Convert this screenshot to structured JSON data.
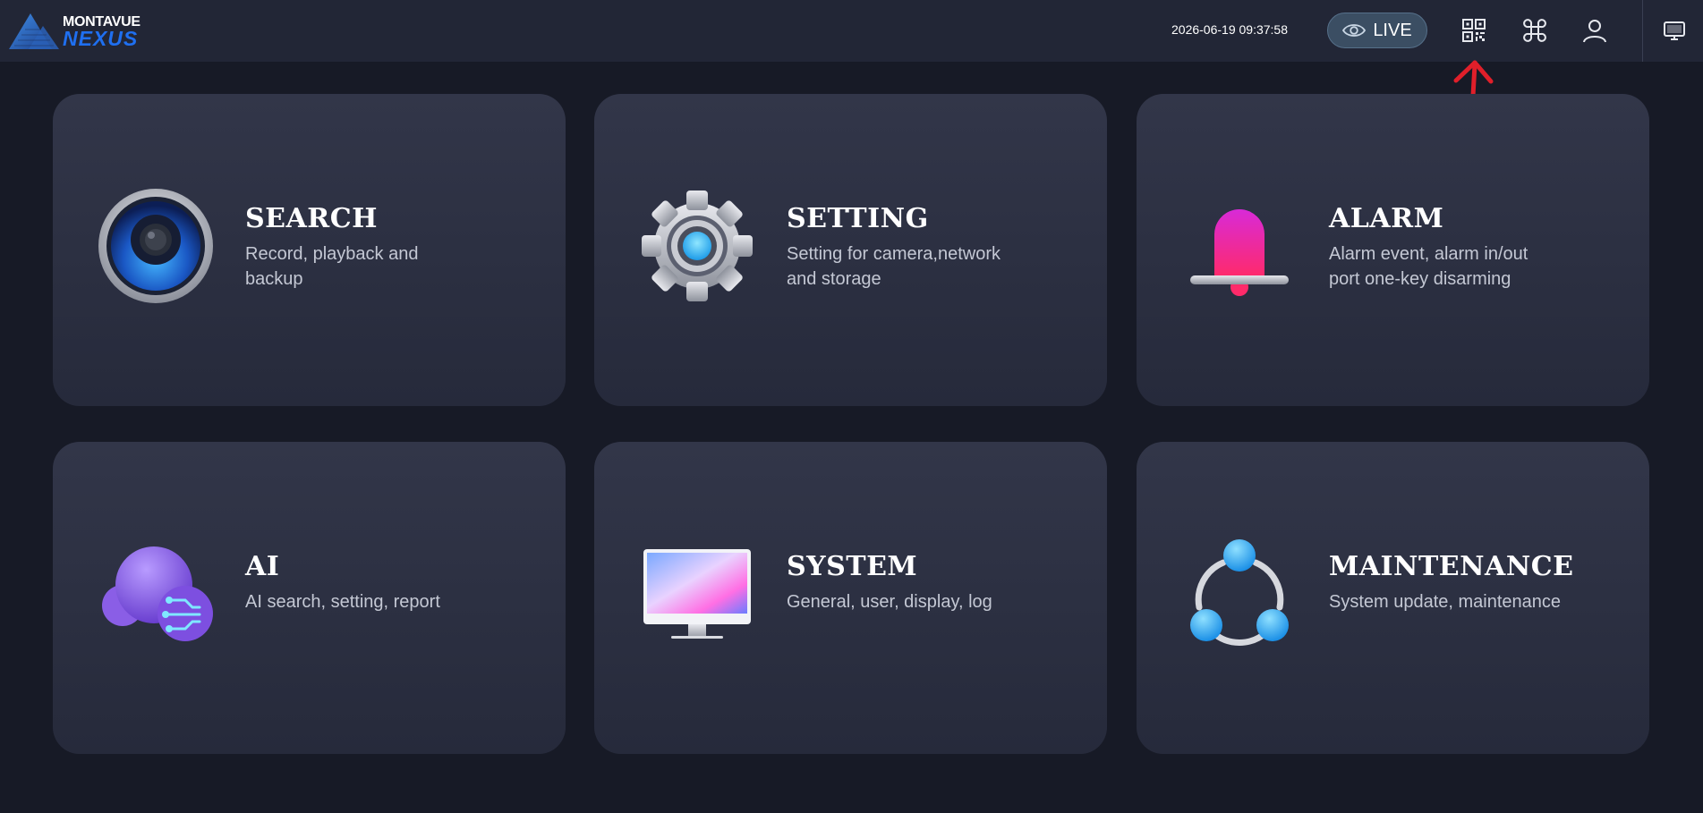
{
  "header": {
    "logo_top": "MONTAVUE",
    "logo_bottom": "NEXUS",
    "datetime": "2026-06-19 09:37:58",
    "live_label": "LIVE"
  },
  "colors": {
    "background": "#171a26",
    "header": "#222636",
    "card": "#2c3043",
    "accent_blue": "#1f6ff0",
    "annotation_red": "#e01f2a"
  },
  "cards": [
    {
      "title": "SEARCH",
      "desc": "Record, playback and backup",
      "icon": "camera-lens-icon"
    },
    {
      "title": "SETTING",
      "desc": "Setting for camera,network and storage",
      "icon": "gear-icon"
    },
    {
      "title": "ALARM",
      "desc": "Alarm event, alarm in/out port one-key disarming",
      "icon": "alarm-bell-icon"
    },
    {
      "title": "AI",
      "desc": "AI search, setting, report",
      "icon": "ai-cloud-icon"
    },
    {
      "title": "SYSTEM",
      "desc": "General, user, display, log",
      "icon": "monitor-icon"
    },
    {
      "title": "MAINTENANCE",
      "desc": "System update, maintenance",
      "icon": "share-network-icon"
    }
  ],
  "toolbar_icons": [
    "eye-icon",
    "qr-code-icon",
    "command-icon",
    "user-icon",
    "display-icon"
  ]
}
